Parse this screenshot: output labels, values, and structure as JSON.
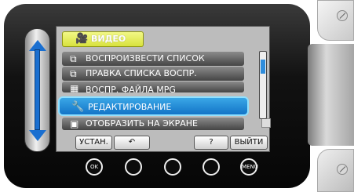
{
  "menu": {
    "title": "ВИДЕО",
    "title_icon": "video-camera-icon",
    "items": [
      {
        "label": "ВОСПРОИЗВЕСТИ СПИСОК",
        "icon": "playlist-icon"
      },
      {
        "label": "ПРАВКА СПИСКА ВОСПР.",
        "icon": "edit-playlist-icon"
      },
      {
        "label": "ВОСПР. ФАЙЛА MPG",
        "icon": "mpg-file-icon"
      },
      {
        "label": "РЕДАКТИРОВАНИЕ",
        "icon": "wrench-icon",
        "selected": true
      },
      {
        "label": "ОТОБРАЗИТЬ НА ЭКРАНЕ",
        "icon": "display-icon"
      }
    ]
  },
  "softkeys": {
    "set": "УСТАН.",
    "back": "↶",
    "help": "?",
    "exit": "ВЫЙТИ"
  },
  "hardkeys": {
    "ok": "OK",
    "menu": "MENU"
  }
}
